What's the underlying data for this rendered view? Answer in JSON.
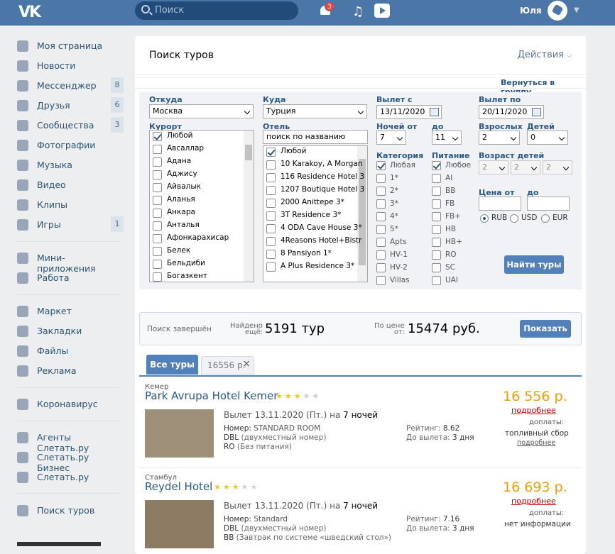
{
  "header": {
    "logo": "VK",
    "search_placeholder": "Поиск",
    "notif_count": "3",
    "user_name": "Юля"
  },
  "nav": [
    {
      "label": "Моя страница",
      "icon": "home-icon",
      "count": ""
    },
    {
      "label": "Новости",
      "icon": "news-icon",
      "count": ""
    },
    {
      "label": "Мессенджер",
      "icon": "message-icon",
      "count": "8"
    },
    {
      "label": "Друзья",
      "icon": "friends-icon",
      "count": "6"
    },
    {
      "label": "Сообщества",
      "icon": "groups-icon",
      "count": "3"
    },
    {
      "label": "Фотографии",
      "icon": "camera-icon",
      "count": ""
    },
    {
      "label": "Музыка",
      "icon": "music-icon",
      "count": ""
    },
    {
      "label": "Видео",
      "icon": "video-icon",
      "count": ""
    },
    {
      "label": "Клипы",
      "icon": "clips-icon",
      "count": ""
    },
    {
      "label": "Игры",
      "icon": "games-icon",
      "count": "1"
    },
    {
      "label": "Мини-приложения",
      "icon": "apps-icon",
      "count": ""
    },
    {
      "label": "Работа",
      "icon": "briefcase-icon",
      "count": ""
    },
    {
      "label": "Маркет",
      "icon": "market-icon",
      "count": ""
    },
    {
      "label": "Закладки",
      "icon": "star-icon",
      "count": ""
    },
    {
      "label": "Файлы",
      "icon": "file-icon",
      "count": ""
    },
    {
      "label": "Реклама",
      "icon": "megaphone-icon",
      "count": ""
    },
    {
      "label": "Коронавирус",
      "icon": "virus-icon",
      "count": ""
    },
    {
      "label": "Агенты Слетать.ру",
      "icon": "group-icon",
      "count": ""
    },
    {
      "label": "Слетать.ру Бизнес",
      "icon": "group-icon",
      "count": ""
    },
    {
      "label": "Слетать.ру",
      "icon": "group-icon",
      "count": ""
    },
    {
      "label": "Поиск туров",
      "icon": "apps-icon",
      "count": ""
    }
  ],
  "panel": {
    "title": "Поиск туров",
    "actions": "Действия",
    "back": "Вернуться в группу"
  },
  "form": {
    "from_label": "Откуда",
    "from_value": "Москва",
    "to_label": "Куда",
    "to_value": "Турция",
    "depart_from_label": "Вылет с",
    "depart_from": "13/11/2020",
    "depart_to_label": "Вылет по",
    "depart_to": "20/11/2020",
    "resort_label": "Курорт",
    "hotel_label": "Отель",
    "hotel_search_placeholder": "поиск по названию",
    "nights_from_label": "Ночей от",
    "nights_from": "7",
    "nights_to_label": "до",
    "nights_to": "11",
    "adults_label": "Взрослых",
    "adults": "2",
    "kids_label": "Детей",
    "kids": "0",
    "category_label": "Категория",
    "meal_label": "Питание",
    "kids_age_label": "Возраст детей",
    "kids_ages": [
      "2",
      "2",
      "2"
    ],
    "price_from_label": "Цена от",
    "price_to_label": "до",
    "currencies": [
      "RUB",
      "USD",
      "EUR"
    ],
    "search_button": "Найти туры",
    "resorts": [
      "Любой",
      "Авсаллар",
      "Адана",
      "Аджису",
      "Айвалык",
      "Аланья",
      "Анкара",
      "Анталья",
      "Афонкарахисар",
      "Белек",
      "Бельдиби",
      "Богазкент"
    ],
    "hotels": [
      "Любой",
      "10 Karakoy, A Morgan",
      "116 Residence Hotel 3",
      "1207 Boutique Hotel 3",
      "2000 Anittepe 3*",
      "3T Residence 3*",
      "4 ODA Cave House 3*",
      "4Reasons Hotel+Bistr",
      "8 Pansiyon 1*",
      "A Plus Residence 3*"
    ],
    "categories": [
      "Любая",
      "1*",
      "2*",
      "3*",
      "4*",
      "5*",
      "Apts",
      "HV-1",
      "HV-2",
      "Villas"
    ],
    "meals": [
      "Любое",
      "AI",
      "BB",
      "FB",
      "FB+",
      "HB",
      "HB+",
      "RO",
      "SC",
      "UAI"
    ]
  },
  "status": {
    "done": "Поиск завершён",
    "found_label_1": "Найдено",
    "found_label_2": "ещё:",
    "found_value": "5191 тур",
    "price_label_1": "По цене",
    "price_label_2": "от:",
    "price_value": "15474 руб.",
    "show_button": "Показать"
  },
  "tabs": {
    "all": "Все туры",
    "second": "16556 р."
  },
  "tours": [
    {
      "location": "Кемер",
      "name": "Park Avrupa Hotel Kemer",
      "stars": 3,
      "departure": "Вылет 13.11.2020 (Пт.) на",
      "nights": "7 ночей",
      "room_label": "Номер:",
      "room": "STANDARD ROOM",
      "dbl": "DBL",
      "dbl_desc": "(двухместный номер)",
      "meal": "RO",
      "meal_desc": "(Без питания)",
      "rating_label": "Рейтинг:",
      "rating": "8.62",
      "till_label": "До вылета:",
      "till": "3 дня",
      "price": "16 556 р.",
      "more": "подробнее",
      "extra_label": "доплаты:",
      "extra_value": "топливный сбор",
      "extra_more": "подробнее"
    },
    {
      "location": "Стамбул",
      "name": "Reydel Hotel",
      "stars": 3,
      "departure": "Вылет 13.11.2020 (Пт.) на",
      "nights": "7 ночей",
      "room_label": "Номер:",
      "room": "Standard",
      "dbl": "DBL",
      "dbl_desc": "(двухместный номер)",
      "meal": "BB",
      "meal_desc": "(Завтрак по системе «шведский стол»)",
      "rating_label": "Рейтинг:",
      "rating": "7.16",
      "till_label": "До вылета:",
      "till": "3 дня",
      "price": "16 693 р.",
      "more": "подробнее",
      "extra_label": "доплаты:",
      "extra_value": "нет информации",
      "extra_more": ""
    }
  ]
}
